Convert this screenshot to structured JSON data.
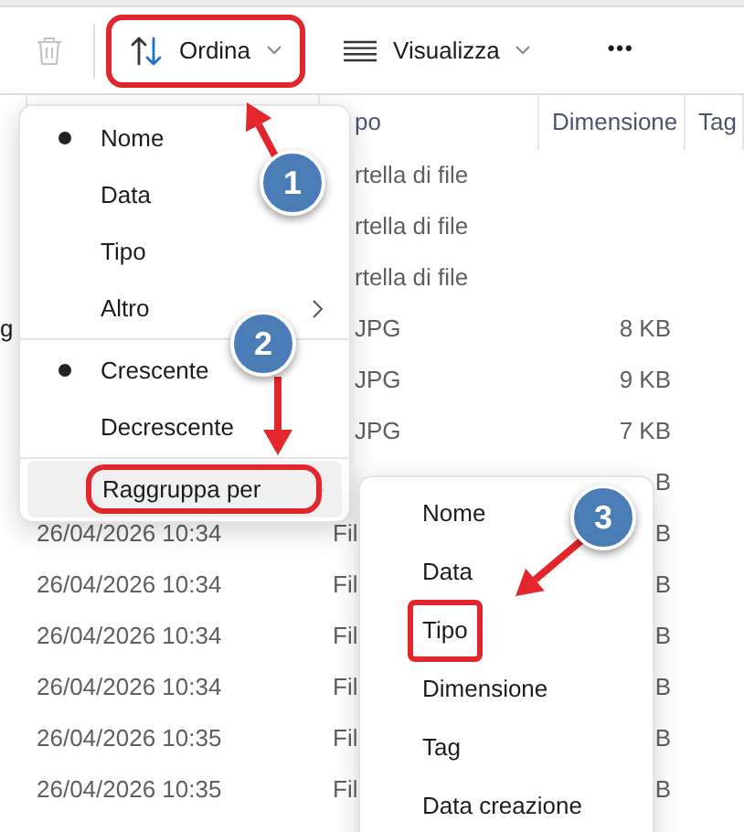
{
  "toolbar": [
    {
      "kind": "delete",
      "disabled": true,
      "annotated": false
    },
    {
      "kind": "sort",
      "label": "Ordina",
      "annotated": true
    },
    {
      "kind": "view",
      "label": "Visualizza",
      "annotated": false
    },
    {
      "kind": "more",
      "label": "•••",
      "annotated": false
    }
  ],
  "table": {
    "columns": [
      {},
      {},
      {
        "label": "po"
      },
      {
        "label": "Dimensione"
      },
      {
        "label": "Tag"
      }
    ],
    "rows": [
      {
        "type": "rtella di file"
      },
      {
        "type": "rtella di file"
      },
      {
        "type": "rtella di file"
      },
      {
        "name": "g",
        "type": "JPG",
        "size": "8 KB"
      },
      {
        "type": "JPG",
        "size": "9 KB"
      },
      {
        "type": "JPG",
        "size": "7 KB"
      },
      {
        "size": "B"
      },
      {
        "date": "26/04/2026 10:34",
        "type": "Fil",
        "size": "B"
      },
      {
        "date": "26/04/2026 10:34",
        "type": "Fil",
        "size": "B"
      },
      {
        "date": "26/04/2026 10:34",
        "type": "Fil",
        "size": "B"
      },
      {
        "date": "26/04/2026 10:34",
        "type": "Fil",
        "size": "B"
      },
      {
        "date": "26/04/2026 10:35",
        "type": "Fil",
        "size": "B"
      },
      {
        "date": "26/04/2026 10:35",
        "type": "Fil",
        "size": "B"
      }
    ]
  },
  "sort_menu": [
    {
      "kind": "option",
      "label": "Nome",
      "selected": true
    },
    {
      "kind": "option",
      "label": "Data",
      "selected": false
    },
    {
      "kind": "option",
      "label": "Tipo",
      "selected": false
    },
    {
      "kind": "submenu",
      "label": "Altro",
      "highlighted": false,
      "annotated": false
    },
    {
      "kind": "separator"
    },
    {
      "kind": "option",
      "label": "Crescente",
      "selected": true
    },
    {
      "kind": "option",
      "label": "Decrescente",
      "selected": false
    },
    {
      "kind": "separator"
    },
    {
      "kind": "submenu",
      "label": "Raggruppa per",
      "highlighted": true,
      "annotated": true
    }
  ],
  "group_menu": [
    {
      "label": "Nome",
      "annotated": false
    },
    {
      "label": "Data",
      "annotated": false
    },
    {
      "label": "Tipo",
      "annotated": true
    },
    {
      "label": "Dimensione",
      "annotated": false
    },
    {
      "label": "Tag",
      "annotated": false
    },
    {
      "label": "Data creazione",
      "annotated": false
    }
  ],
  "callouts": [
    {
      "number": "1"
    },
    {
      "number": "2"
    },
    {
      "number": "3"
    }
  ]
}
